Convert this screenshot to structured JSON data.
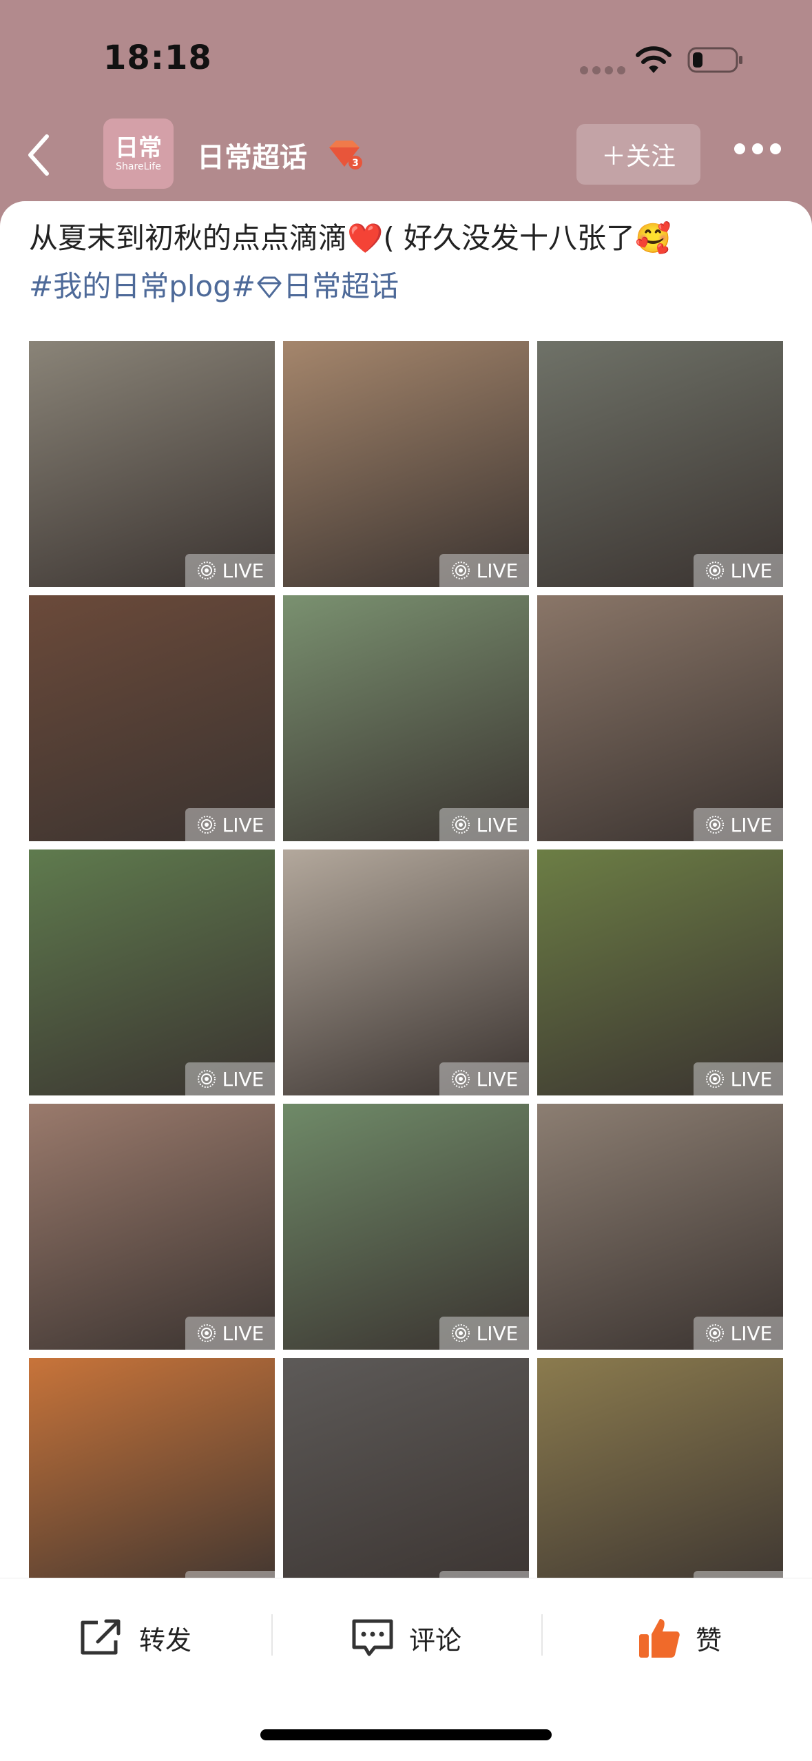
{
  "status_bar": {
    "time": "18:18"
  },
  "header": {
    "logo_main": "日常",
    "logo_sub": "ShareLife",
    "title": "日常超话",
    "level_badge": "3",
    "follow_label": "＋关注",
    "colors": {
      "background": "#b28a8d",
      "badge": "#e8553a"
    }
  },
  "post": {
    "text": "从夏末到初秋的点点滴滴",
    "text_after": "( 好久没发十八张了",
    "emoji_heart": "❤️",
    "emoji_face": "🥰",
    "tag_1": "#我的日常plog#",
    "tag_2": "日常超话"
  },
  "photos": {
    "live_label": "LIVE",
    "items": [
      {
        "name": "photo-two-women-doorway",
        "bg": "#8a8478"
      },
      {
        "name": "photo-selfie-couch",
        "bg": "#a5866c"
      },
      {
        "name": "photo-cafe-dog",
        "bg": "#6f7268"
      },
      {
        "name": "photo-selfie-braid",
        "bg": "#6b4a3a"
      },
      {
        "name": "photo-park-dog-walk",
        "bg": "#7a9170"
      },
      {
        "name": "photo-selfie-hand",
        "bg": "#8a7668"
      },
      {
        "name": "photo-garden-canopy",
        "bg": "#5f7b4e"
      },
      {
        "name": "photo-car-selfie",
        "bg": "#b3a89c"
      },
      {
        "name": "photo-orange-cat",
        "bg": "#6c7e45"
      },
      {
        "name": "photo-selfie-closeup",
        "bg": "#9a7a6c"
      },
      {
        "name": "photo-hill-dogs",
        "bg": "#6f8a68"
      },
      {
        "name": "photo-puppy-hug",
        "bg": "#8c7e72"
      },
      {
        "name": "photo-orange-door",
        "bg": "#c8743a"
      },
      {
        "name": "photo-sunglasses-selfie",
        "bg": "#5d5a58"
      },
      {
        "name": "photo-restaurant-meal",
        "bg": "#8b7b4e"
      }
    ]
  },
  "actions": {
    "share": "转发",
    "comment": "评论",
    "like": "赞",
    "colors": {
      "like_icon": "#f06a2a"
    }
  }
}
